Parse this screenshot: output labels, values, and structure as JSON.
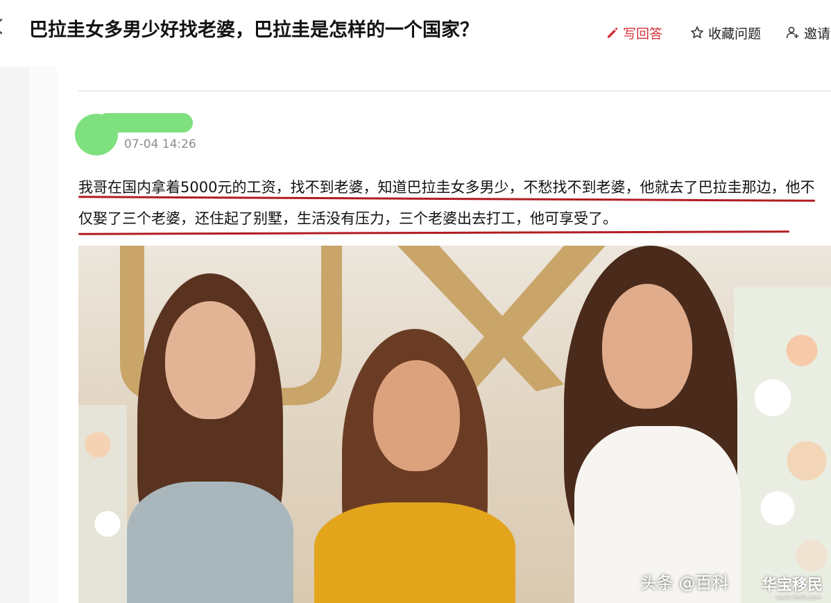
{
  "header": {
    "title": "巴拉圭女多男少好找老婆，巴拉圭是怎样的一个国家？",
    "actions": {
      "write_answer": "写回答",
      "favorite": "收藏问题",
      "invite": "邀请"
    },
    "accent_color": "#d6333a"
  },
  "answer": {
    "timestamp": "07-04 14:26",
    "content": "我哥在国内拿着5000元的工资，找不到老婆，知道巴拉圭女多男少，不愁找不到老婆，他就去了巴拉圭那边，他不仅娶了三个老婆，还住起了别墅，生活没有压力，三个老婆出去打工，他可享受了。",
    "underline_color": "#b01c22"
  },
  "image": {
    "source_tag": "头条 @百科",
    "watermark": "华宝移民",
    "watermark_url": "www.ihb8.com"
  },
  "icons": [
    "back-arrow-icon",
    "pencil-icon",
    "star-icon",
    "add-user-icon"
  ]
}
